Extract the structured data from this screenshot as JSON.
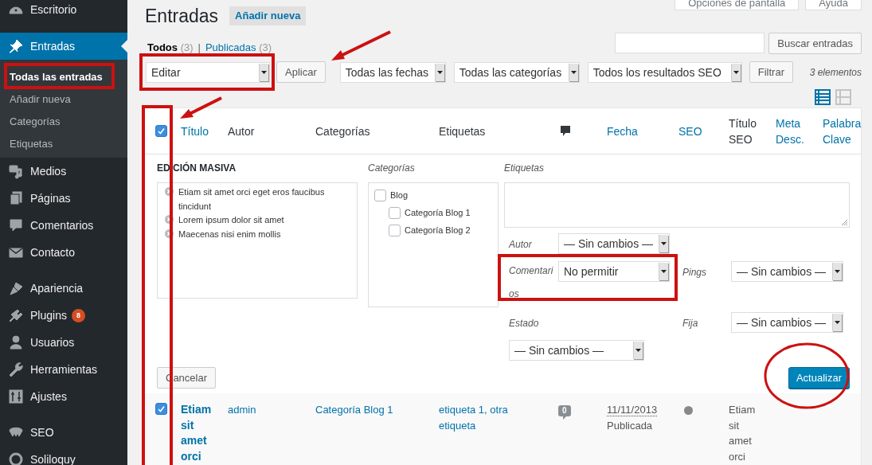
{
  "sidebar": {
    "items": [
      {
        "label": "Escritorio",
        "selected": false
      },
      {
        "label": "Entradas",
        "selected": true,
        "submenu": [
          {
            "label": "Todas las entradas",
            "selected": true
          },
          {
            "label": "Añadir nueva",
            "selected": false
          },
          {
            "label": "Categorías",
            "selected": false
          },
          {
            "label": "Etiquetas",
            "selected": false
          }
        ]
      },
      {
        "label": "Medios",
        "selected": false
      },
      {
        "label": "Páginas",
        "selected": false
      },
      {
        "label": "Comentarios",
        "selected": false
      },
      {
        "label": "Contacto",
        "selected": false
      },
      {
        "label": "Apariencia",
        "selected": false
      },
      {
        "label": "Plugins",
        "selected": false,
        "badge": "8"
      },
      {
        "label": "Usuarios",
        "selected": false
      },
      {
        "label": "Herramientas",
        "selected": false
      },
      {
        "label": "Ajustes",
        "selected": false
      },
      {
        "label": "SEO",
        "selected": false
      },
      {
        "label": "Soliloquy",
        "selected": false
      }
    ]
  },
  "header": {
    "title": "Entradas",
    "add_button": "Añadir nueva",
    "screen_options": "Opciones de pantalla",
    "help": "Ayuda"
  },
  "filters": {
    "views": [
      {
        "label": "Todos",
        "count": "(3)",
        "selected": true
      },
      {
        "label": "Publicadas",
        "count": "(3)",
        "selected": false
      }
    ],
    "separator": "|",
    "search_button": "Buscar entradas",
    "bulk_action": "Editar",
    "apply_button": "Aplicar",
    "dropdowns": [
      "Todas las fechas",
      "Todas las categorías",
      "Todos los resultados SEO"
    ],
    "filter_button": "Filtrar",
    "item_count": "3 elementos",
    "view_modes": [
      {
        "kind": "list",
        "selected": true
      },
      {
        "kind": "excerpt",
        "selected": false
      }
    ]
  },
  "table": {
    "select_all_checked": true,
    "columns": [
      {
        "kind": "text",
        "label": "Título",
        "sortable": true
      },
      {
        "kind": "text",
        "label": "Autor",
        "sortable": false
      },
      {
        "kind": "text",
        "label": "Categorías",
        "sortable": false
      },
      {
        "kind": "text",
        "label": "Etiquetas",
        "sortable": false
      },
      {
        "kind": "icon"
      },
      {
        "kind": "text",
        "label": "Fecha",
        "sortable": true
      },
      {
        "kind": "text",
        "label": "SEO",
        "sortable": true
      },
      {
        "kind": "text",
        "label": "Título SEO",
        "sortable": false
      },
      {
        "kind": "text",
        "label": "Meta Desc.",
        "sortable": true
      },
      {
        "kind": "text",
        "label": "Palabra Clave",
        "sortable": true
      }
    ],
    "bulk_edit": {
      "title": "EDICIÓN MASIVA",
      "posts": [
        "Etiam sit amet orci eget eros faucibus tincidunt",
        "Lorem ipsum dolor sit amet",
        "Maecenas nisi enim mollis"
      ],
      "categories_label": "Categorías",
      "categories": [
        {
          "label": "Blog",
          "checked": false,
          "children": [
            {
              "label": "Categoría Blog 1",
              "checked": false
            },
            {
              "label": "Categoría Blog 2",
              "checked": false
            }
          ]
        }
      ],
      "tags_label": "Etiquetas",
      "author": {
        "label": "Autor",
        "value": "— Sin cambios —"
      },
      "comments": {
        "label": "Comentarios",
        "value": "No permitir"
      },
      "pings": {
        "label": "Pings",
        "value": "— Sin cambios —"
      },
      "status": {
        "label": "Estado",
        "value": "— Sin cambios —"
      },
      "sticky": {
        "label": "Fija",
        "value": "— Sin cambios —"
      },
      "cancel_button": "Cancelar",
      "update_button": "Actualizar"
    },
    "rows": [
      {
        "checked": true,
        "title": "Etiam sit amet orci",
        "author": "admin",
        "categories": "Categoría Blog 1",
        "tags": "etiqueta 1, otra etiqueta",
        "comments": "0",
        "date": "11/11/2013",
        "status": "Publicada",
        "seo_title": "Etiam sit amet orci"
      }
    ]
  }
}
